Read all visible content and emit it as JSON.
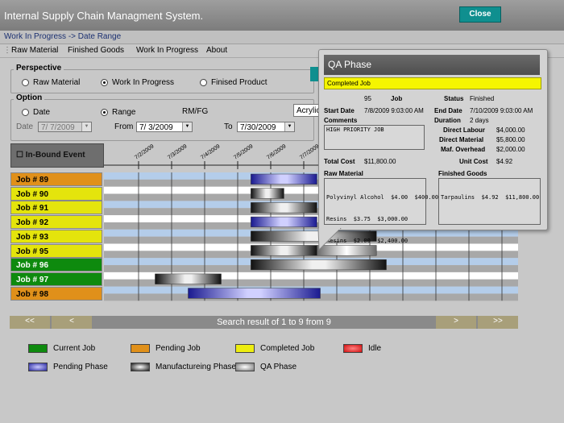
{
  "app": {
    "title": "Internal Supply Chain Managment System.",
    "close_label": "Close"
  },
  "breadcrumb": "Work In Progress -> Date Range",
  "menu": [
    "Raw Material",
    "Finished Goods",
    "Work In Progress",
    "About"
  ],
  "perspective": {
    "title": "Perspective",
    "options": [
      {
        "label": "Raw Material",
        "selected": false
      },
      {
        "label": "Work In Progress",
        "selected": true
      },
      {
        "label": "Finised Product",
        "selected": false
      }
    ]
  },
  "option": {
    "title": "Option",
    "date_label": "Date",
    "range_label": "Range",
    "rmfg_label": "RM/FG",
    "product_select": "Acrylic",
    "date_field_label": "Date",
    "date_value": "7/ 7/2009",
    "from_label": "From",
    "from_value": "7/ 3/2009",
    "to_label": "To",
    "to_value": "7/30/2009",
    "selected": "Range"
  },
  "inbound_label": "In-Bound Event",
  "timeline_dates": [
    "7/2/2009",
    "7/3/2009",
    "7/4/2009",
    "7/5/2009",
    "7/6/2009",
    "7/7/2009",
    "7/8/2009"
  ],
  "jobs": [
    {
      "label": "Job # 89",
      "status": "Pending Job"
    },
    {
      "label": "Job # 90",
      "status": "Completed Job"
    },
    {
      "label": "Job # 91",
      "status": "Completed Job"
    },
    {
      "label": "Job # 92",
      "status": "Completed Job"
    },
    {
      "label": "Job # 93",
      "status": "Completed Job"
    },
    {
      "label": "Job # 95",
      "status": "Completed Job"
    },
    {
      "label": "Job # 96",
      "status": "Current Job"
    },
    {
      "label": "Job # 97",
      "status": "Current Job"
    },
    {
      "label": "Job # 98",
      "status": "Pending Job"
    }
  ],
  "pager": {
    "first": "<<",
    "prev": "<",
    "next": ">",
    "last": ">>",
    "result_text": "Search result of 1 to 9 from 9"
  },
  "legend": [
    {
      "label": "Current Job",
      "color": "#0e8a0e"
    },
    {
      "label": "Pending Job",
      "color": "#e0901a"
    },
    {
      "label": "Completed Job",
      "color": "#eded10"
    },
    {
      "label": "Idle",
      "color": "#e02020"
    },
    {
      "label": "Pending Phase",
      "color": "#3030b0"
    },
    {
      "label": "Manufactureing Phase",
      "color": "#222222"
    },
    {
      "label": "QA Phase",
      "color": "#8a8a8a"
    }
  ],
  "qa_popup": {
    "title": "QA Phase",
    "status_bar": "Completed Job",
    "job_label": "Job",
    "job_value": "95",
    "status_label": "Status",
    "status_value": "Finished",
    "start_label": "Start Date",
    "start_value": "7/8/2009 9:03:00 AM",
    "end_label": "End Date",
    "end_value": "7/10/2009 9:03:00 AM",
    "duration_label": "Duration",
    "duration_value": "2 days",
    "comments_label": "Comments",
    "comments_value": "HIGH PRIORITY JOB",
    "direct_labour_label": "Direct Labour",
    "direct_labour_value": "$4,000.00",
    "direct_material_label": "Direct Material",
    "direct_material_value": "$5,800.00",
    "maf_overhead_label": "Maf. Overhead",
    "maf_overhead_value": "$2,000.00",
    "total_cost_label": "Total Cost",
    "total_cost_value": "$11,800.00",
    "unit_cost_label": "Unit Cost",
    "unit_cost_value": "$4.92",
    "raw_material_label": "Raw Material",
    "raw_material_lines": [
      "Polyvinyl Alcohol  $4.00  $400.00",
      "Resins  $3.75  $3,000.00",
      "Resins  $2.00  $2,400.00"
    ],
    "finished_goods_label": "Finished Goods",
    "finished_goods_lines": [
      "Tarpaulins  $4.92  $11,800.00"
    ]
  }
}
